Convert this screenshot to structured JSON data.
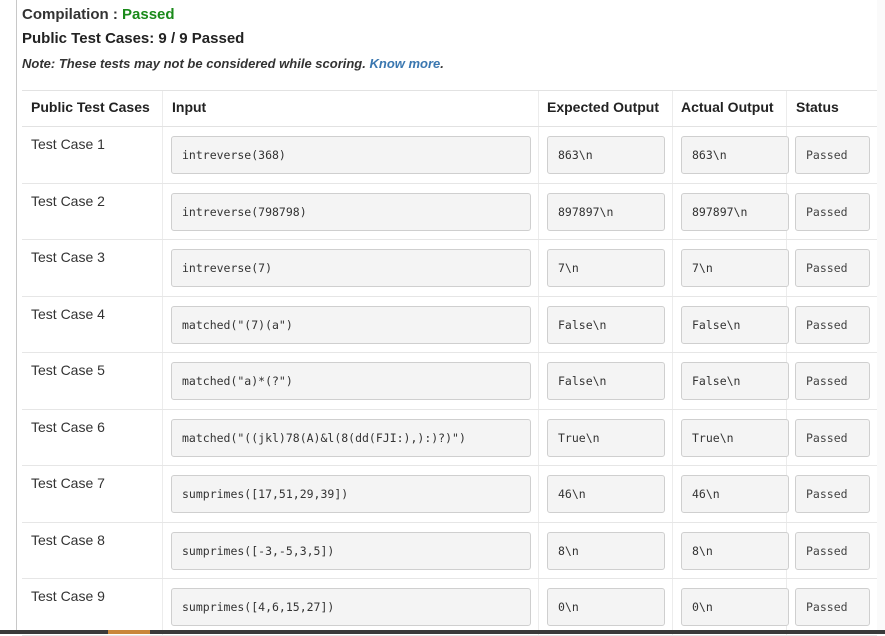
{
  "compilation": {
    "label": "Compilation :",
    "status": "Passed"
  },
  "public_tests": {
    "label": "Public Test Cases: 9 / 9 Passed"
  },
  "note": {
    "text": "Note: These tests may not be considered while scoring.",
    "link": "Know more",
    "suffix": "."
  },
  "table": {
    "headers": [
      "Public Test Cases",
      "Input",
      "Expected Output",
      "Actual Output",
      "Status"
    ],
    "rows": [
      {
        "name": "Test Case 1",
        "input": "intreverse(368)",
        "expected": "863\\n",
        "actual": "863\\n",
        "status": "Passed"
      },
      {
        "name": "Test Case 2",
        "input": "intreverse(798798)",
        "expected": "897897\\n",
        "actual": "897897\\n",
        "status": "Passed"
      },
      {
        "name": "Test Case 3",
        "input": "intreverse(7)",
        "expected": "7\\n",
        "actual": "7\\n",
        "status": "Passed"
      },
      {
        "name": "Test Case 4",
        "input": "matched(\"(7)(a\")",
        "expected": "False\\n",
        "actual": "False\\n",
        "status": "Passed"
      },
      {
        "name": "Test Case 5",
        "input": "matched(\"a)*(?\")",
        "expected": "False\\n",
        "actual": "False\\n",
        "status": "Passed"
      },
      {
        "name": "Test Case 6",
        "input": "matched(\"((jkl)78(A)&l(8(dd(FJI:),):)?)\")",
        "expected": "True\\n",
        "actual": "True\\n",
        "status": "Passed"
      },
      {
        "name": "Test Case 7",
        "input": "sumprimes([17,51,29,39])",
        "expected": "46\\n",
        "actual": "46\\n",
        "status": "Passed"
      },
      {
        "name": "Test Case 8",
        "input": "sumprimes([-3,-5,3,5])",
        "expected": "8\\n",
        "actual": "8\\n",
        "status": "Passed"
      },
      {
        "name": "Test Case 9",
        "input": "sumprimes([4,6,15,27])",
        "expected": "0\\n",
        "actual": "0\\n",
        "status": "Passed"
      }
    ]
  },
  "colors": {
    "passed_green": "#1a8a1a",
    "link_blue": "#3a77b0",
    "box_bg": "#f4f4f4"
  }
}
